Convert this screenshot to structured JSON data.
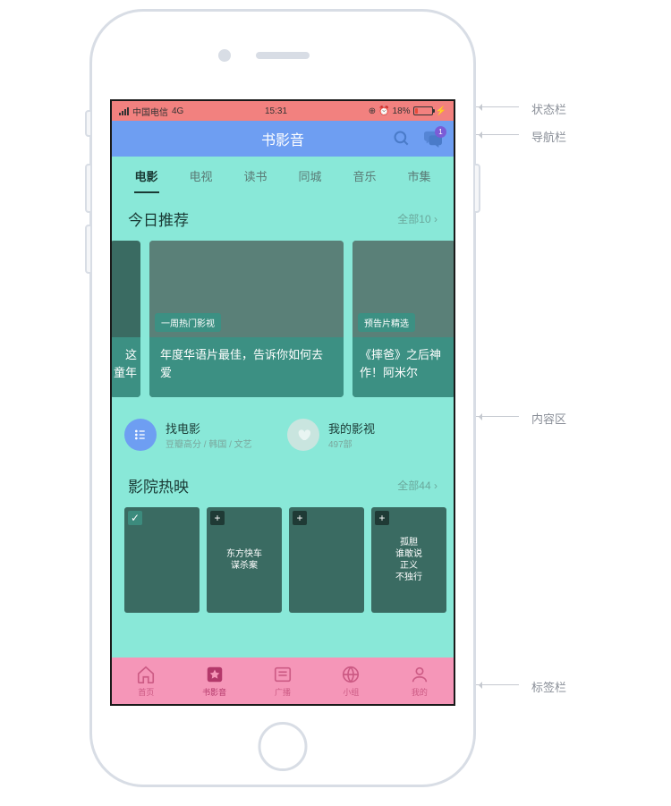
{
  "status_bar": {
    "carrier": "中国电信",
    "network": "4G",
    "time": "15:31",
    "battery_pct": "18%"
  },
  "nav_bar": {
    "title": "书影音",
    "badge_count": "1"
  },
  "category_tabs": [
    "电影",
    "电视",
    "读书",
    "同城",
    "音乐",
    "市集"
  ],
  "active_category_index": 0,
  "today_rec": {
    "title": "今日推荐",
    "more": "全部10",
    "cards": [
      {
        "peek_left_title": "这\n童年"
      },
      {
        "tag": "一周热门影视",
        "title": "年度华语片最佳，告诉你如何去爱"
      },
      {
        "tag": "预告片精选",
        "title": "《摔爸》之后神作！阿米尔"
      }
    ]
  },
  "quick_links": [
    {
      "title": "找电影",
      "sub": "豆瓣高分 / 韩国 / 文艺"
    },
    {
      "title": "我的影视",
      "sub": "497部"
    }
  ],
  "cinema": {
    "title": "影院热映",
    "more": "全部44",
    "posters": [
      {
        "added": true,
        "label": ""
      },
      {
        "added": false,
        "label": "东方快车\n谋杀案"
      },
      {
        "added": false,
        "label": ""
      },
      {
        "added": false,
        "label": "孤胆\n谁敢说\n正义\n不独行"
      }
    ]
  },
  "tab_bar": {
    "items": [
      {
        "label": "首页"
      },
      {
        "label": "书影音"
      },
      {
        "label": "广播"
      },
      {
        "label": "小组"
      },
      {
        "label": "我的"
      }
    ],
    "active_index": 1
  },
  "annotations": {
    "status": "状态栏",
    "nav": "导航栏",
    "content": "内容区",
    "tab": "标签栏"
  }
}
